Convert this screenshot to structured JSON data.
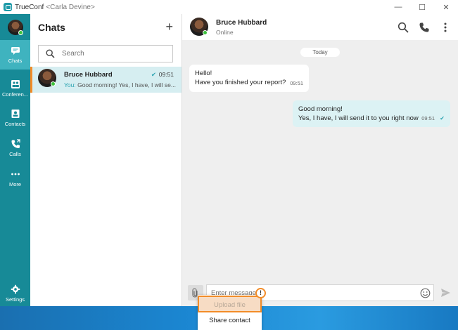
{
  "window": {
    "app_name": "TrueConf",
    "user": "<Carla Devine>",
    "minimize": "—",
    "maximize": "☐",
    "close": "✕"
  },
  "rail": {
    "items": [
      {
        "label": "Chats",
        "icon": "chat-icon",
        "active": true
      },
      {
        "label": "Conferen...",
        "icon": "conference-icon",
        "active": false
      },
      {
        "label": "Contacts",
        "icon": "contacts-icon",
        "active": false
      },
      {
        "label": "Calls",
        "icon": "calls-icon",
        "active": false
      },
      {
        "label": "More",
        "icon": "more-icon",
        "active": false
      },
      {
        "label": "Settings",
        "icon": "gear-icon",
        "active": false
      }
    ]
  },
  "chats": {
    "title": "Chats",
    "add_label": "+",
    "search_placeholder": "Search",
    "list": [
      {
        "name": "Bruce Hubbard",
        "time": "09:51",
        "check": "✔",
        "preview_prefix": "You:",
        "preview_text": "Good morning! Yes, I have, I will se..."
      }
    ]
  },
  "conversation": {
    "contact_name": "Bruce Hubbard",
    "contact_status": "Online",
    "date_separator": "Today",
    "messages": [
      {
        "direction": "in",
        "lines": [
          "Hello!",
          "Have you finished your report?"
        ],
        "time": "09:51"
      },
      {
        "direction": "out",
        "lines": [
          "Good morning!",
          "Yes, I have, I will send it to you right now"
        ],
        "time": "09:51",
        "check": "✔"
      }
    ],
    "input_placeholder": "Enter message",
    "send_icon": "send-icon"
  },
  "attach_menu": {
    "items": [
      "Upload file",
      "Share contact"
    ],
    "warning_badge": "!"
  },
  "colors": {
    "rail": "#178a97",
    "rail_active": "#3fb3bf",
    "accent": "#2aa3b0",
    "highlight_orange": "#f28c28",
    "selected_chat": "#d6eef1",
    "outgoing_bubble": "#dcf2f4"
  }
}
